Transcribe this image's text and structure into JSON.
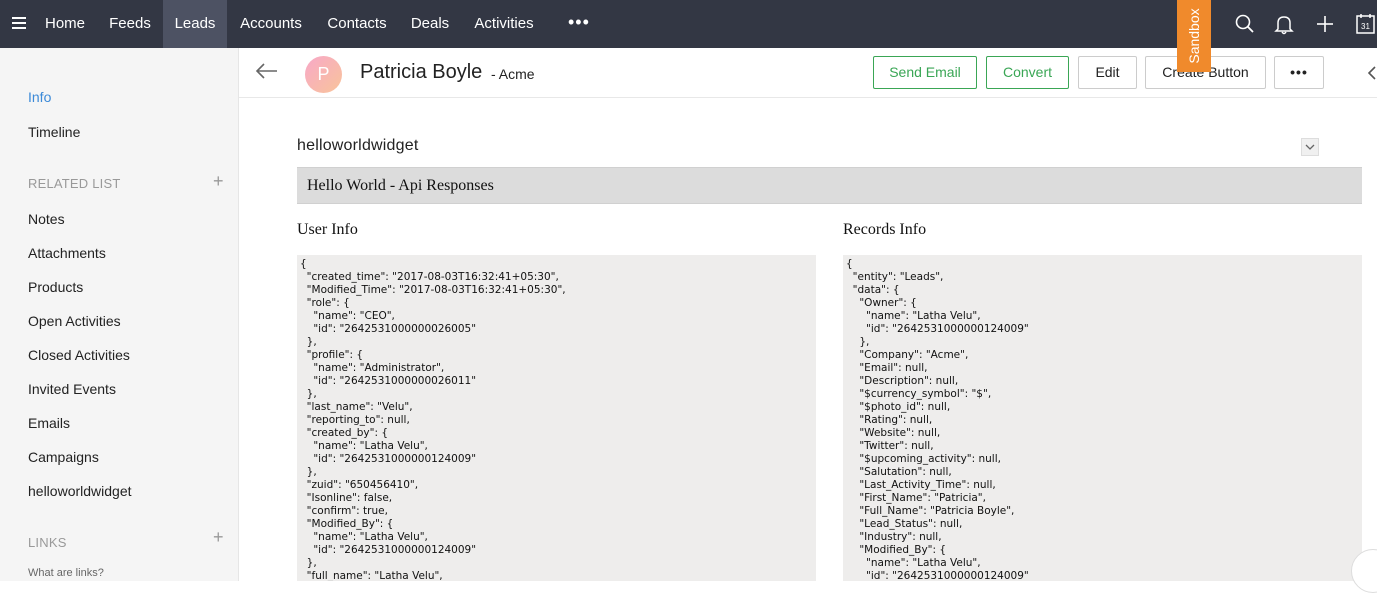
{
  "nav": {
    "tabs": [
      {
        "label": "Home"
      },
      {
        "label": "Feeds"
      },
      {
        "label": "Leads"
      },
      {
        "label": "Accounts"
      },
      {
        "label": "Contacts"
      },
      {
        "label": "Deals"
      },
      {
        "label": "Activities"
      }
    ],
    "active_tab": "Leads",
    "more_label": "•••",
    "sandbox_label": "Sandbox",
    "calendar_day": "31",
    "icons": [
      "menu-icon",
      "search-icon",
      "bell-icon",
      "plus-icon",
      "calendar-icon"
    ],
    "active_bg": "#4d5263",
    "bar_bg": "#333744",
    "sandbox_color": "#f08a2c"
  },
  "sidebar": {
    "info": "Info",
    "timeline": "Timeline",
    "related_list_heading": "RELATED LIST",
    "related_items": [
      "Notes",
      "Attachments",
      "Products",
      "Open Activities",
      "Closed Activities",
      "Invited Events",
      "Emails",
      "Campaigns",
      "helloworldwidget"
    ],
    "links_heading": "LINKS",
    "links_help": "What are links?",
    "plus_symbol": "+",
    "accent": "#3c8ad8"
  },
  "record": {
    "avatar_letter": "P",
    "name": "Patricia Boyle",
    "company": "- Acme",
    "buttons": {
      "send_email": "Send Email",
      "convert": "Convert",
      "edit": "Edit",
      "create_button": "Create Button",
      "more": "•••"
    },
    "button_green": "#3aa655"
  },
  "widget": {
    "title": "helloworldwidget",
    "bar_title": "Hello World - Api Responses",
    "user_info": {
      "title": "User Info",
      "lines": [
        "{",
        "  \"created_time\": \"2017-08-03T16:32:41+05:30\",",
        "  \"Modified_Time\": \"2017-08-03T16:32:41+05:30\",",
        "  \"role\": {",
        "    \"name\": \"CEO\",",
        "    \"id\": \"2642531000000026005\"",
        "  },",
        "  \"profile\": {",
        "    \"name\": \"Administrator\",",
        "    \"id\": \"2642531000000026011\"",
        "  },",
        "  \"last_name\": \"Velu\",",
        "  \"reporting_to\": null,",
        "  \"created_by\": {",
        "    \"name\": \"Latha Velu\",",
        "    \"id\": \"2642531000000124009\"",
        "  },",
        "  \"zuid\": \"650456410\",",
        "  \"Isonline\": false,",
        "  \"confirm\": true,",
        "  \"Modified_By\": {",
        "    \"name\": \"Latha Velu\",",
        "    \"id\": \"2642531000000124009\"",
        "  },",
        "  \"full_name\": \"Latha Velu\","
      ]
    },
    "records_info": {
      "title": "Records Info",
      "lines": [
        "{",
        "  \"entity\": \"Leads\",",
        "  \"data\": {",
        "    \"Owner\": {",
        "      \"name\": \"Latha Velu\",",
        "      \"id\": \"2642531000000124009\"",
        "    },",
        "    \"Company\": \"Acme\",",
        "    \"Email\": null,",
        "    \"Description\": null,",
        "    \"$currency_symbol\": \"$\",",
        "    \"$photo_id\": null,",
        "    \"Rating\": null,",
        "    \"Website\": null,",
        "    \"Twitter\": null,",
        "    \"$upcoming_activity\": null,",
        "    \"Salutation\": null,",
        "    \"Last_Activity_Time\": null,",
        "    \"First_Name\": \"Patricia\",",
        "    \"Full_Name\": \"Patricia Boyle\",",
        "    \"Lead_Status\": null,",
        "    \"Industry\": null,",
        "    \"Modified_By\": {",
        "      \"name\": \"Latha Velu\",",
        "      \"id\": \"2642531000000124009\""
      ]
    }
  }
}
